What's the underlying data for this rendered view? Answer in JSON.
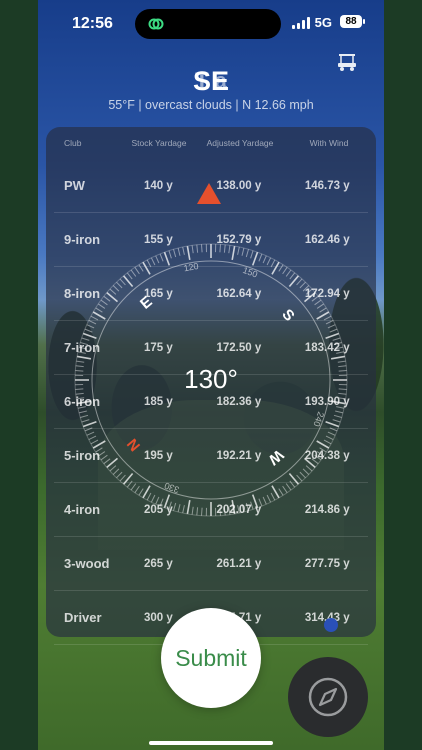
{
  "status_bar": {
    "time": "12:56",
    "network": "5G",
    "battery": "88"
  },
  "header": {
    "city_partial": "T        a",
    "heading": "SE",
    "weather": "55°F  | overcast clouds  | N 12.66 mph"
  },
  "table": {
    "headers": [
      "Club",
      "Stock Yardage",
      "Adjusted Yardage",
      "With Wind"
    ],
    "rows": [
      {
        "club": "PW",
        "stock": "140 y",
        "adjusted": "138.00 y",
        "wind": "146.73 y"
      },
      {
        "club": "9-iron",
        "stock": "155 y",
        "adjusted": "152.79 y",
        "wind": "162.46 y"
      },
      {
        "club": "8-iron",
        "stock": "165 y",
        "adjusted": "162.64 y",
        "wind": "172.94 y"
      },
      {
        "club": "7-iron",
        "stock": "175 y",
        "adjusted": "172.50 y",
        "wind": "183.42 y"
      },
      {
        "club": "6-iron",
        "stock": "185 y",
        "adjusted": "182.36 y",
        "wind": "193.90 y"
      },
      {
        "club": "5-iron",
        "stock": "195 y",
        "adjusted": "192.21 y",
        "wind": "204.38 y"
      },
      {
        "club": "4-iron",
        "stock": "205 y",
        "adjusted": "202.07 y",
        "wind": "214.86 y"
      },
      {
        "club": "3-wood",
        "stock": "265 y",
        "adjusted": "261.21 y",
        "wind": "277.75 y"
      },
      {
        "club": "Driver",
        "stock": "300 y",
        "adjusted": "295.71 y",
        "wind": "314.43 y"
      }
    ]
  },
  "compass": {
    "heading_text": "130°",
    "cardinals": {
      "N": "N",
      "E": "E",
      "S": "S",
      "W": "W"
    },
    "degree_labels": [
      "120",
      "150",
      "240",
      "330"
    ],
    "north_color": "#e5502d"
  },
  "actions": {
    "submit_label": "Submit",
    "compass_button": "compass-icon"
  },
  "colors": {
    "accent_green": "#3a8c4a",
    "needle": "#e5502d"
  }
}
